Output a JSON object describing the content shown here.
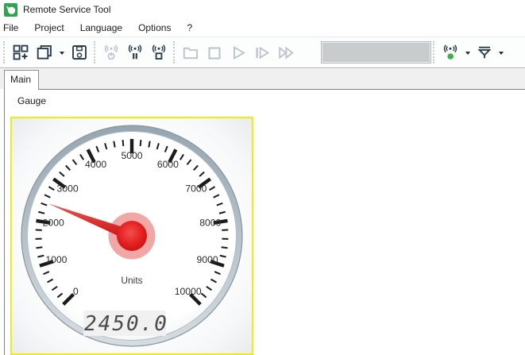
{
  "window": {
    "title": "Remote Service Tool",
    "app_icon": "green-app-icon"
  },
  "menu": {
    "items": [
      {
        "label": "File"
      },
      {
        "label": "Project"
      },
      {
        "label": "Language"
      },
      {
        "label": "Options"
      },
      {
        "label": "?"
      }
    ]
  },
  "toolbar": {
    "colors": {
      "enabled": "#2c3d4f",
      "disabled": "#b9c3cd",
      "status_dot": "#3fae46"
    },
    "groups": [
      {
        "buttons": [
          "add-view-icon",
          "cascade-windows-icon (dropdown)",
          "save-icon"
        ]
      },
      {
        "buttons": [
          "connect-power-icon (disabled)",
          "connection-pause-icon",
          "connection-stop-icon"
        ]
      },
      {
        "buttons": [
          "folder-icon (disabled)",
          "stop-icon (disabled)",
          "play-icon (disabled)",
          "step-forward-icon (disabled)",
          "fast-forward-icon (disabled)"
        ],
        "status_display_text": ""
      },
      {
        "buttons": [
          "connection-status-icon (green dot, dropdown)",
          "filter-icon (dropdown)"
        ]
      }
    ]
  },
  "tabs": [
    {
      "label": "Main",
      "selected": true
    }
  ],
  "content": {
    "group_label": "Gauge"
  },
  "gauge": {
    "min": 0,
    "max": 10000,
    "major_step": 1000,
    "minor_steps_per_interval": 5,
    "start_angle_deg": 225,
    "sweep_deg": 270,
    "value": 2450,
    "units_label": "Units",
    "display_value": "2450.0",
    "major_tick_labels": [
      "0",
      "1000",
      "2000",
      "3000",
      "4000",
      "5000",
      "6000",
      "7000",
      "8000",
      "9000",
      "10000"
    ],
    "colors": {
      "selection_border": "#eded12",
      "rim_top": "#96a5b0",
      "rim_bottom": "#d6dde1",
      "rim_stroke": "#8795a0",
      "face": "#ffffff",
      "face_edge": "#eff2f3",
      "tick": "#1b1b1b",
      "label": "#2a2a2a",
      "needle_light": "#ef5252",
      "needle_dark": "#c51111",
      "hub": "#e32020",
      "halo": "#f2a7a7",
      "units": "#3d3d3d",
      "lcd_bg": "#f1f1f1",
      "lcd_text": "#4b4b4b"
    }
  }
}
